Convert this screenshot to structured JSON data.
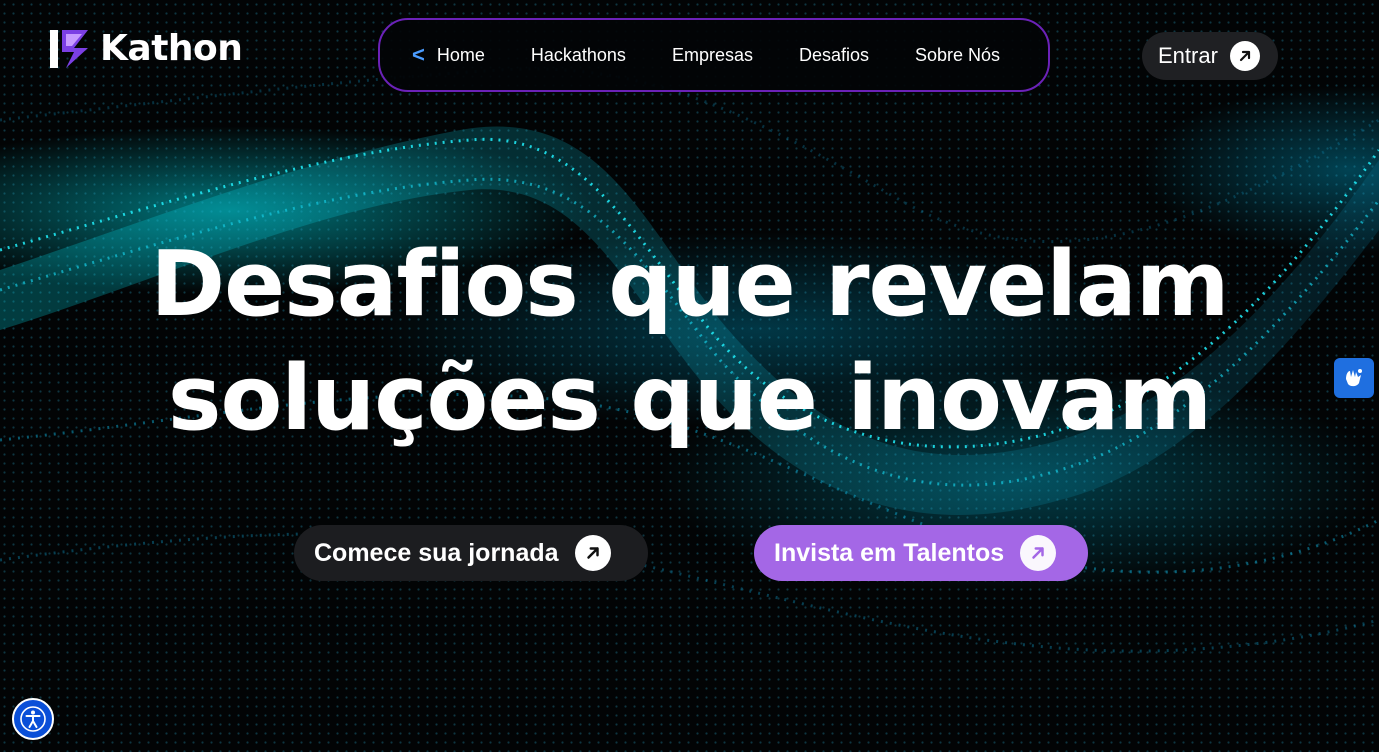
{
  "brand": {
    "name": "Kathon"
  },
  "nav": {
    "back_icon": "chevron-left-icon",
    "items": [
      {
        "label": "Home"
      },
      {
        "label": "Hackathons"
      },
      {
        "label": "Empresas"
      },
      {
        "label": "Desafios"
      },
      {
        "label": "Sobre Nós"
      }
    ]
  },
  "header": {
    "login_label": "Entrar",
    "login_icon": "arrow-up-right-icon"
  },
  "hero": {
    "line1": "Desafios que revelam",
    "line2": "soluções que inovam"
  },
  "cta": {
    "start_label": "Comece sua jornada",
    "invest_label": "Invista em Talentos"
  },
  "widgets": {
    "vlibras_icon": "sign-language-hands-icon",
    "accessibility_icon": "accessibility-person-icon"
  },
  "colors": {
    "nav_border": "#6b22b8",
    "nav_chevron": "#4b9cff",
    "invest_button": "#a467e6",
    "start_button": "#1c1d20",
    "vlibras_bg": "#1f6fe0",
    "a11y_bg": "#0a4fd8",
    "wave_cyan": "#19d3e0"
  }
}
